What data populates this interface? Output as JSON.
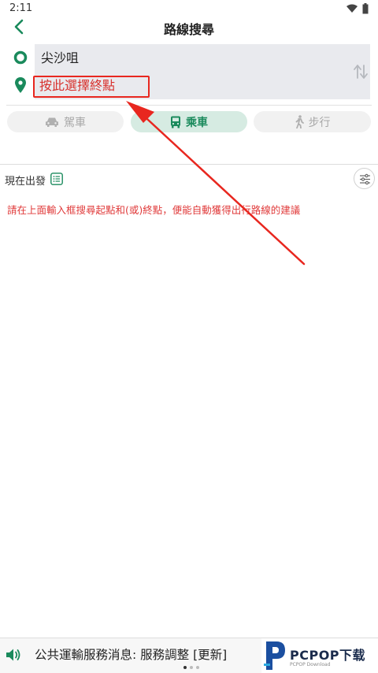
{
  "status_bar": {
    "time": "2:11"
  },
  "header": {
    "title": "路線搜尋"
  },
  "search": {
    "origin_value": "尖沙咀",
    "destination_placeholder": "按此選擇終點"
  },
  "modes": [
    {
      "label": "駕車",
      "icon": "car-icon",
      "active": false
    },
    {
      "label": "乘車",
      "icon": "bus-icon",
      "active": true
    },
    {
      "label": "步行",
      "icon": "walk-icon",
      "active": false
    }
  ],
  "options": {
    "departure_label": "現在出發",
    "hint": "請在上面輸入框搜尋起點和(或)終點，便能自動獲得出行路線的建議"
  },
  "footer": {
    "news": "公共運輸服務消息: 服務調整 [更新]"
  },
  "watermark": {
    "brand": "PCPOP下载",
    "sub": "PCPOP Download"
  },
  "colors": {
    "accent_green": "#1a8a5c",
    "hint_red": "#e03a3a",
    "annotation_red": "#e8271f"
  }
}
